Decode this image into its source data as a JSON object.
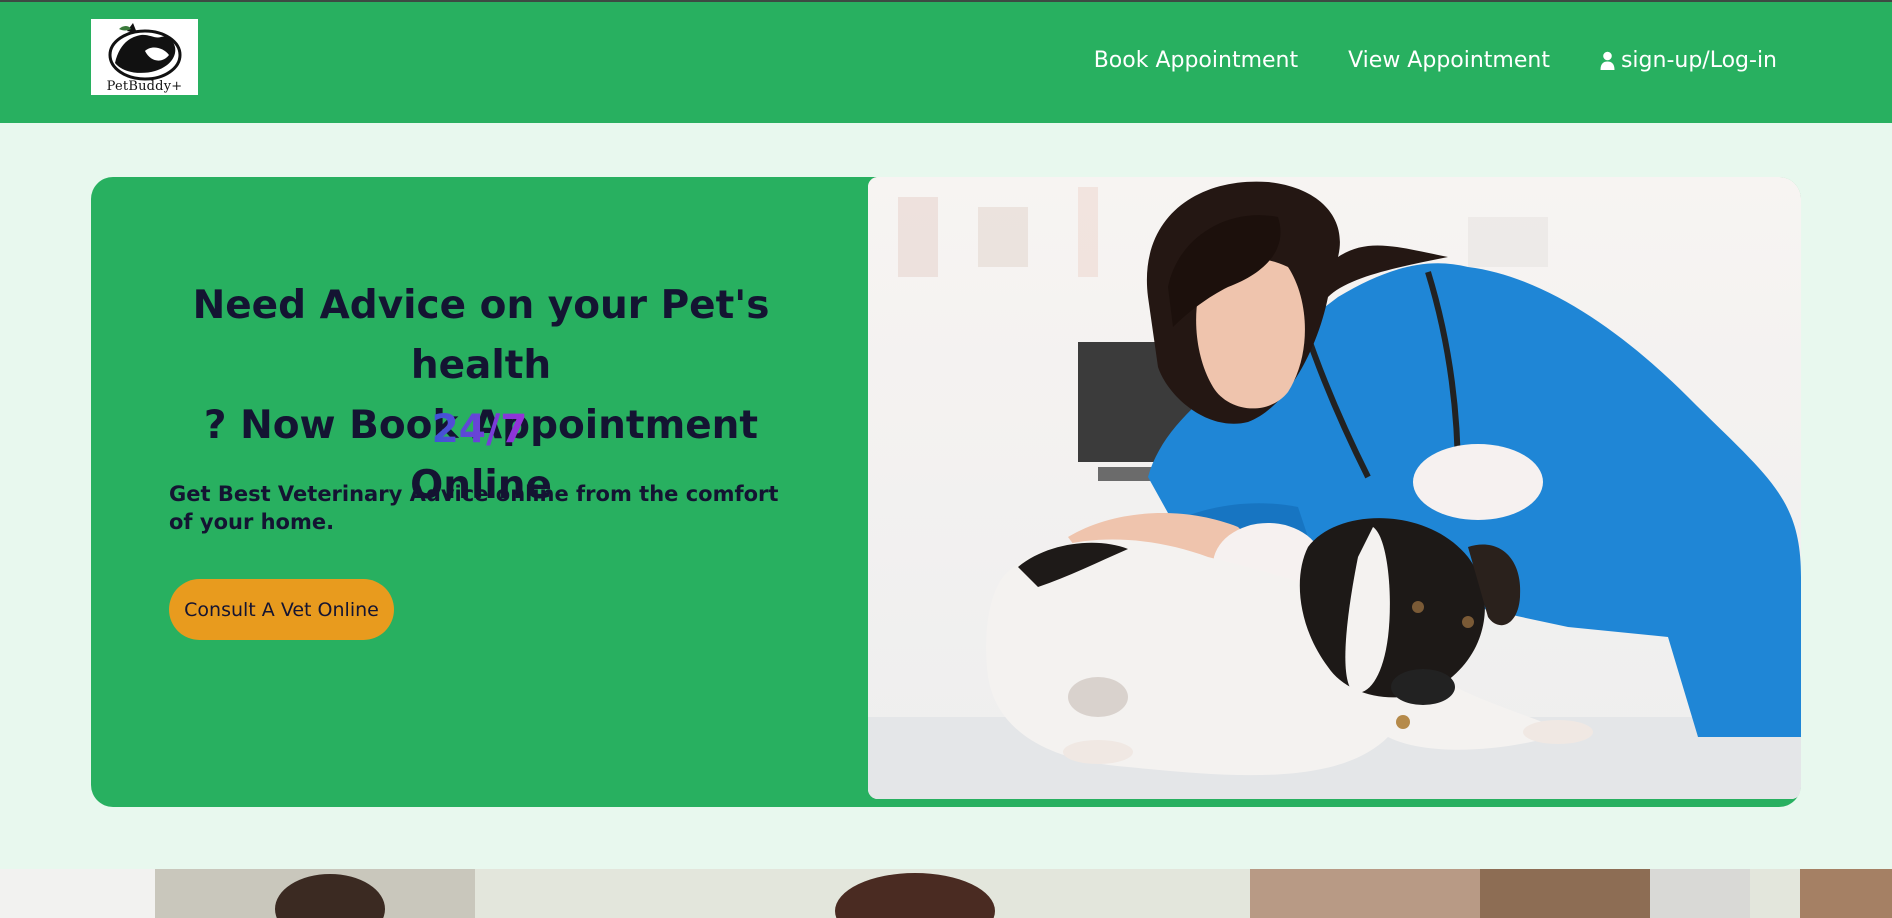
{
  "brand": {
    "logo_text": "PetBuddy+"
  },
  "nav": {
    "items": [
      {
        "label": "Book Appointment"
      },
      {
        "label": "View Appointment"
      },
      {
        "label": "sign-up/Log-in",
        "icon": "user-icon"
      }
    ]
  },
  "hero": {
    "headline_line1": "Need Advice on your Pet's health",
    "headline_line2": "? Now Book Appointment Online",
    "tagline": "24/7",
    "subtext": "Get Best Veterinary Advice online from the comfort of your home.",
    "cta_label": "Consult A Vet Online",
    "photo_subject": "veterinarian examining a dog"
  },
  "colors": {
    "brand_green": "#28b060",
    "page_background": "#e8f8ee",
    "cta_orange": "#e89b1e",
    "text_dark": "#141432",
    "tagline_gradient_start": "#3c56d6",
    "tagline_gradient_end": "#9b2fd8"
  }
}
